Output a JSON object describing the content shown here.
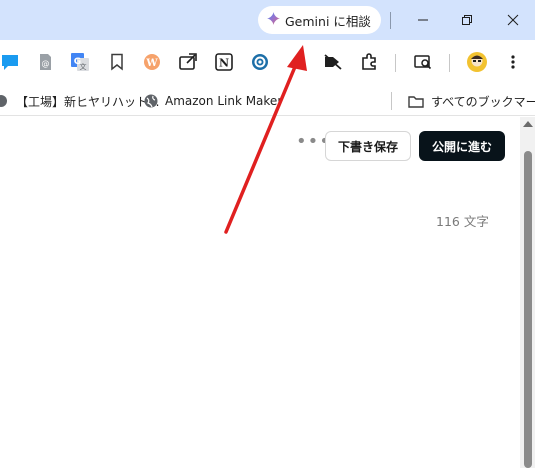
{
  "titlebar": {
    "gemini_label": "Gemini に相談",
    "window_controls": [
      "minimize-icon",
      "restore-icon",
      "close-icon"
    ]
  },
  "toolbar": {
    "extension_icons": [
      "chat-bubble-icon",
      "page-extension-icon",
      "google-translate-icon",
      "bookmark-icon",
      "wordpress-icon",
      "screenshot-icon",
      "notion-icon",
      "extension-icon",
      "mute-extension-icon",
      "puzzle-extensions-icon",
      "page-search-icon",
      "profile-avatar",
      "menu-kebab-icon"
    ]
  },
  "bookmarks": {
    "item1": "【工場】新ヒヤリハット...",
    "item2": "Amazon Link Maker",
    "all_bookmarks": "すべてのブックマーク"
  },
  "editor": {
    "more_label": "•••",
    "draft_label": "下書き保存",
    "publish_label": "公開に進む",
    "char_count": "116 文字"
  },
  "colors": {
    "titlebar": "#d3e3fd",
    "publish_bg": "#08131a",
    "annotation_arrow": "#e02020"
  }
}
